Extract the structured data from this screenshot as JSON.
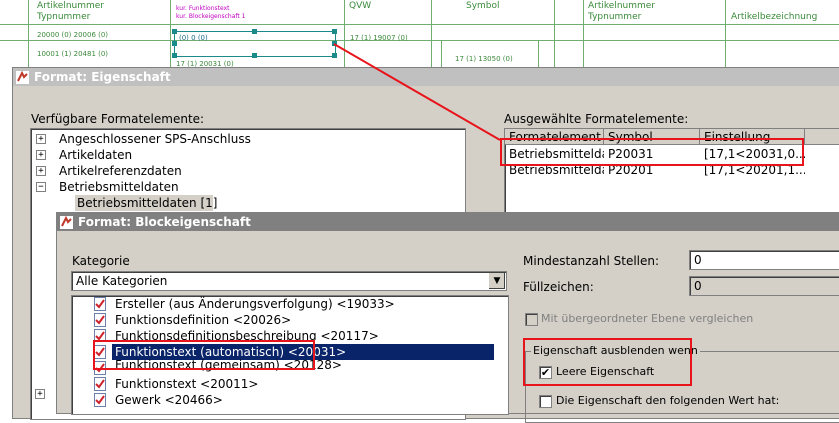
{
  "background": {
    "col_headers": {
      "artikelnummer_1": "Artikelnummer",
      "typnummer_1": "Typnummer",
      "qvw": "QVW",
      "symbol": "Symbol",
      "artikelnummer_2": "Artikelnummer",
      "typnummer_2": "Typnummer",
      "artikelbezeichnung": "Artikelbezeichnung"
    },
    "pink_line_1": "kur. Funktionstext",
    "pink_line_2": "kur. Blockeigenschaft 1",
    "cells": {
      "r1_c1": "20000 (0) 20006 (0)",
      "r1_sel": "(0) 0 (0)",
      "r1_qvw": "17 (1) 19007 (0)",
      "r2_c1": "10001 (1) 20481 (0)",
      "r2_symbol": "17 (1) 13050 (0)",
      "r3_sel": "17 (1) 20031 (0)"
    }
  },
  "dialog_eigenschaft": {
    "title": "Format: Eigenschaft",
    "available_label": "Verfügbare Formatelemente:",
    "selected_label": "Ausgewählte Formatelemente:",
    "tree": [
      {
        "sign": "+",
        "label": "Angeschlossener SPS-Anschluss"
      },
      {
        "sign": "+",
        "label": "Artikeldaten"
      },
      {
        "sign": "+",
        "label": "Artikelreferenzdaten"
      },
      {
        "sign": "−",
        "label": "Betriebsmitteldaten"
      },
      {
        "sign": "",
        "label": "Betriebsmitteldaten [1]"
      }
    ],
    "grid_headers": [
      "Formatelement",
      "Symbol",
      "Einstellung"
    ],
    "grid_rows": [
      [
        "Betriebsmittelda...",
        "P20031",
        "[17,1<20031,0..."
      ],
      [
        "Betriebsmittelda...",
        "P20201",
        "[17,1<20201,1..."
      ]
    ]
  },
  "dialog_block": {
    "title": "Format: Blockeigenschaft",
    "kategorie_label": "Kategorie",
    "kategorie_value": "Alle Kategorien",
    "list": [
      "Ersteller (aus Änderungsverfolgung) <19033>",
      "Funktionsdefinition <20026>",
      "Funktionsdefinitionsbeschreibung <20117>",
      "Funktionstext (automatisch) <20031>",
      "Funktionstext (gemeinsam) <20128>",
      "Funktionstext <20011>",
      "Gewerk <20466>"
    ],
    "selected_index": 3,
    "mindestanzahl_label": "Mindestanzahl Stellen:",
    "mindestanzahl_value": "0",
    "fuellzeichen_label": "Füllzeichen:",
    "fuellzeichen_value": "0",
    "compare_label": "Mit übergeordneter Ebene vergleichen",
    "group_label": "Eigenschaft ausblenden wenn",
    "leere_label": "Leere Eigenschaft",
    "leere_checked": true,
    "wert_label": "Die Eigenschaft den folgenden Wert hat:",
    "wert_checked": false
  },
  "colors": {
    "highlight": "#e8141b",
    "selection": "#0a246a",
    "dialog_bg": "#d4d0c8",
    "drawing_green": "#3a8a3a"
  }
}
